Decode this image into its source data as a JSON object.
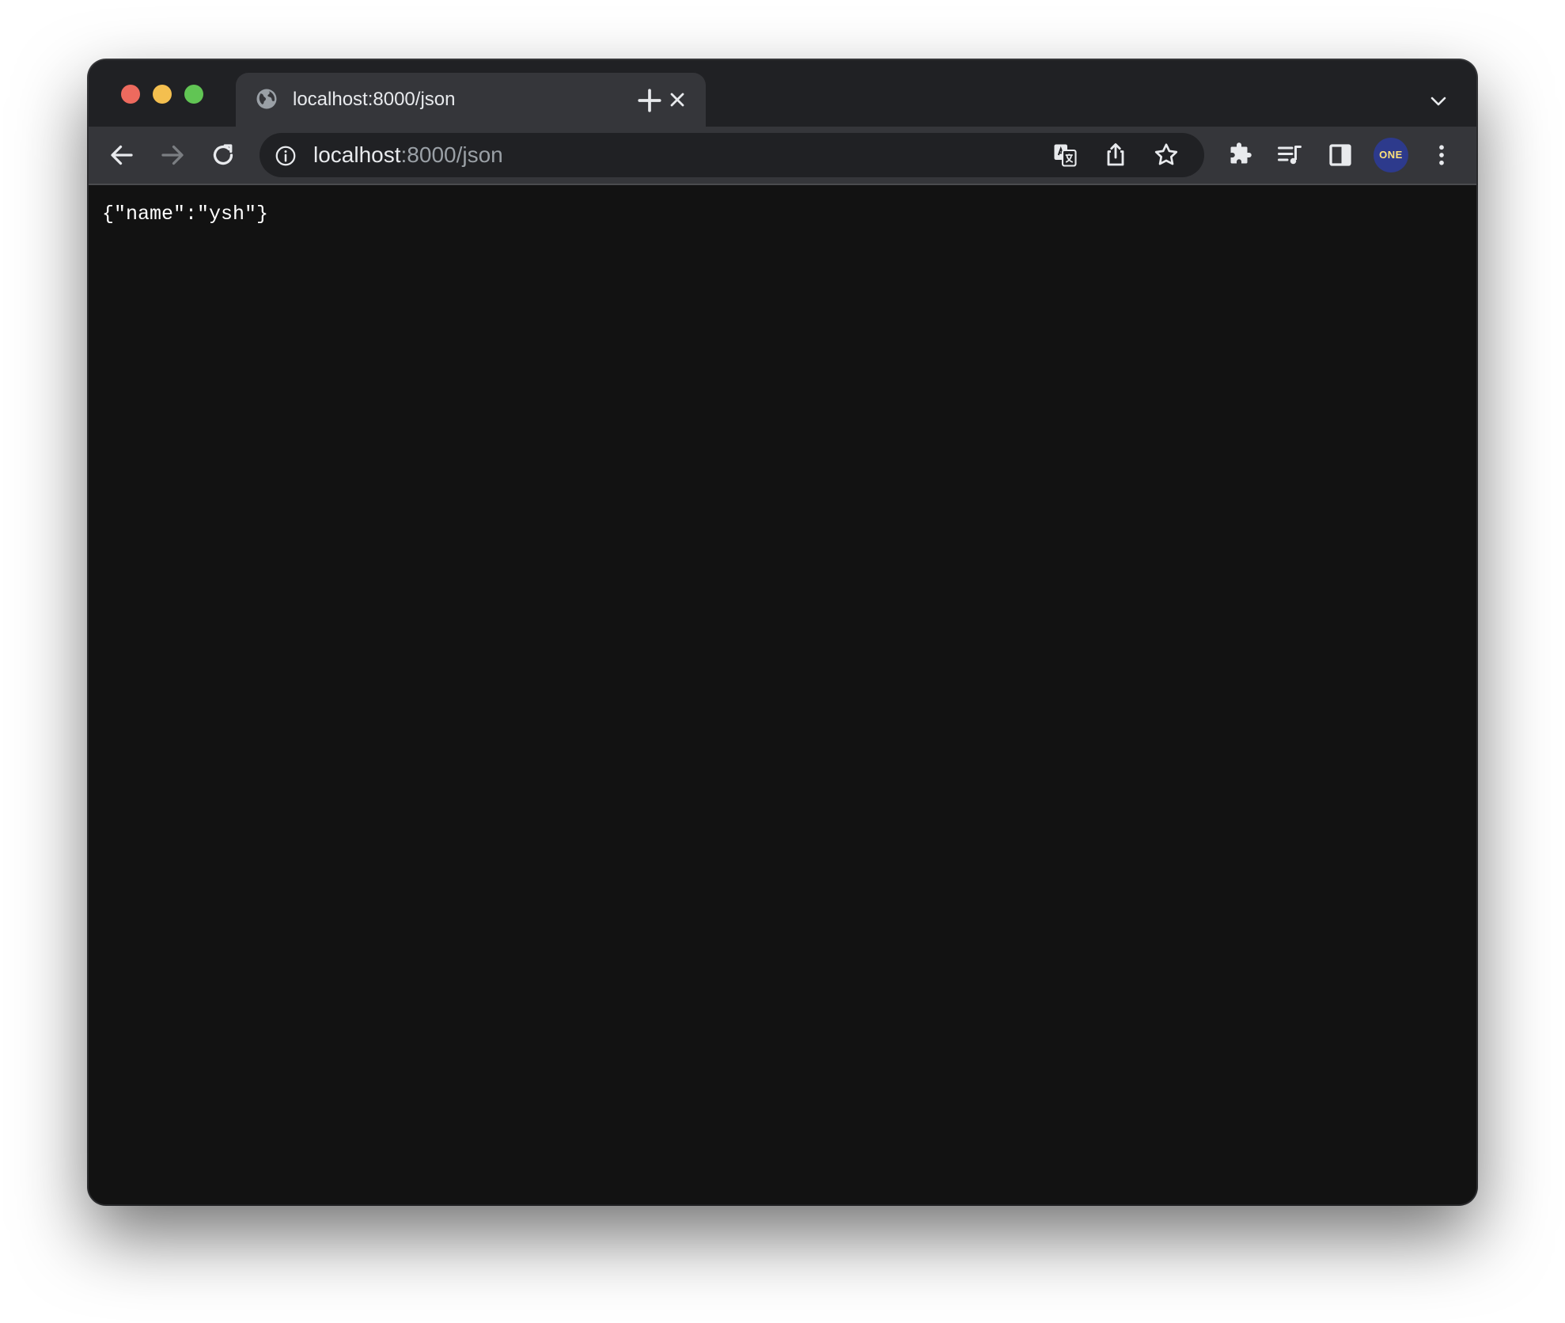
{
  "tab": {
    "title": "localhost:8000/json"
  },
  "omnibox": {
    "host": "localhost",
    "rest": ":8000/json"
  },
  "profile": {
    "avatar_label": "ONE"
  },
  "page": {
    "body_text": "{\"name\":\"ysh\"}"
  },
  "colors": {
    "tabstrip": "#202124",
    "toolbar": "#35363a",
    "omnibox": "#202124",
    "content": "#121212",
    "close": "#ed6a5e",
    "minimize": "#f4bf4f",
    "maximize": "#61c554",
    "avatar_bg": "#2d3a8c",
    "avatar_text": "#ffe27a"
  },
  "icons": {
    "window_controls": [
      "close-icon",
      "minimize-icon",
      "maximize-icon"
    ],
    "tab": [
      "globe-icon",
      "close-icon"
    ],
    "strip": [
      "plus-icon",
      "chevron-down-icon"
    ],
    "toolbar": [
      "arrow-left-icon",
      "arrow-right-icon",
      "reload-icon",
      "info-icon",
      "translate-icon",
      "share-icon",
      "star-icon",
      "puzzle-icon",
      "playlist-icon",
      "sidepanel-icon",
      "more-vertical-icon"
    ]
  }
}
